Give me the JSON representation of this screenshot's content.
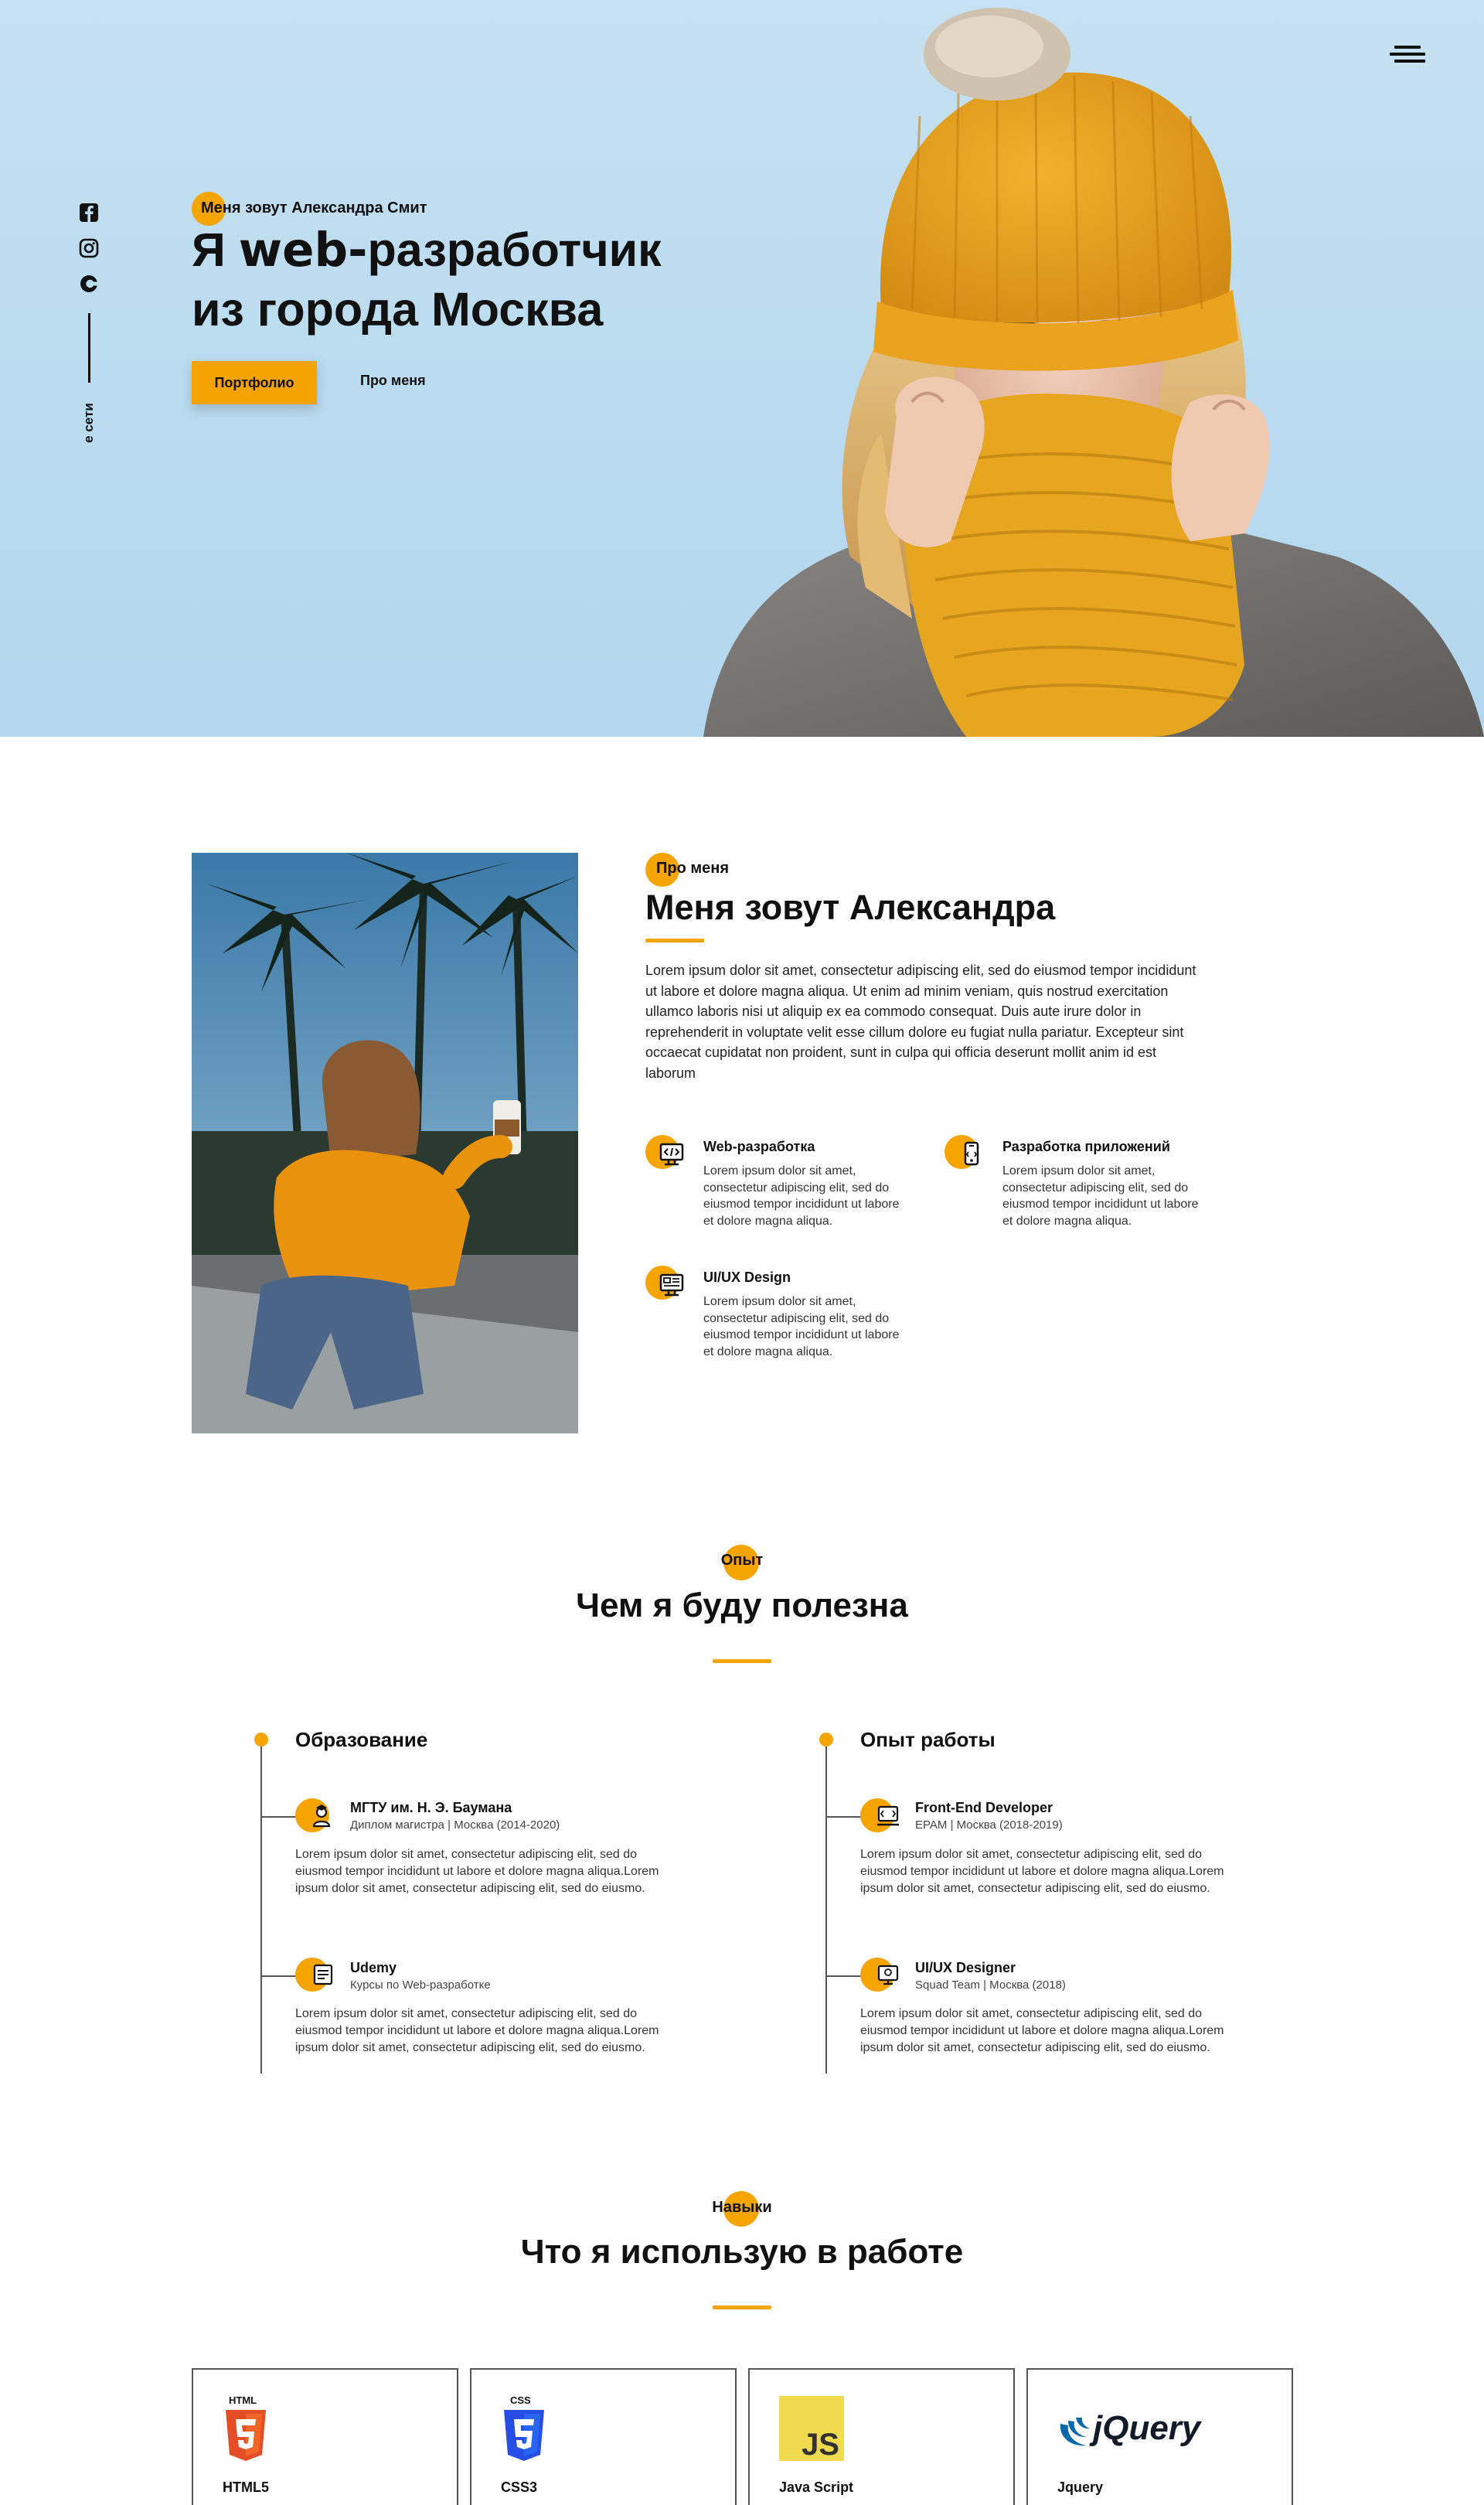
{
  "hero": {
    "eyebrow": "Меня зовут Александра Смит",
    "title_part1": "Я ",
    "title_bold": "web-",
    "title_part2": "разработчик",
    "title_line2": "из города Москва",
    "btn_portfolio": "Портфолио",
    "btn_about": "Про меня",
    "social_label": "е сети",
    "social_icons": [
      "facebook-icon",
      "instagram-icon",
      "codepen-icon"
    ]
  },
  "about": {
    "eyebrow": "Про меня",
    "title": "Меня зовут Александра",
    "text": "Lorem ipsum dolor sit amet, consectetur adipiscing elit, sed do eiusmod tempor incididunt ut labore et dolore magna aliqua. Ut enim ad minim veniam, quis nostrud exercitation ullamco laboris nisi ut aliquip ex ea commodo consequat. Duis aute irure dolor in reprehenderit in voluptate velit esse cillum dolore eu fugiat nulla pariatur. Excepteur sint occaecat cupidatat non proident, sunt in culpa qui officia deserunt mollit anim id est laborum",
    "services": [
      {
        "title": "Web-разработка",
        "text": "Lorem ipsum dolor sit amet, consectetur adipiscing elit, sed do eiusmod tempor incididunt ut labore et dolore magna aliqua.",
        "icon": "code-monitor-icon"
      },
      {
        "title": "Разработка приложений",
        "text": "Lorem ipsum dolor sit amet, consectetur adipiscing elit, sed do eiusmod tempor incididunt ut labore et dolore magna aliqua.",
        "icon": "mobile-icon"
      },
      {
        "title": "UI/UX Design",
        "text": "Lorem ipsum dolor sit amet, consectetur adipiscing elit, sed do eiusmod tempor incididunt ut labore et dolore magna aliqua.",
        "icon": "design-monitor-icon"
      }
    ]
  },
  "experience": {
    "eyebrow": "Опыт",
    "title": "Чем я буду полезна",
    "education": {
      "heading": "Образование",
      "items": [
        {
          "title": "МГТУ им. Н. Э. Баумана",
          "sub": "Диплом магистра | Москва (2014-2020)",
          "text": "Lorem ipsum dolor sit amet, consectetur adipiscing elit, sed do eiusmod tempor incididunt ut labore et dolore magna aliqua.Lorem ipsum dolor sit amet, consectetur adipiscing elit, sed do eiusmo."
        },
        {
          "title": "Udemy",
          "sub": "Курсы по Web-разработке",
          "text": "Lorem ipsum dolor sit amet, consectetur adipiscing elit, sed do eiusmod tempor incididunt ut labore et dolore magna aliqua.Lorem ipsum dolor sit amet, consectetur adipiscing elit, sed do eiusmo."
        }
      ]
    },
    "work": {
      "heading": "Опыт работы",
      "items": [
        {
          "title": "Front-End Developer",
          "sub": "EPAM | Москва (2018-2019)",
          "text": "Lorem ipsum dolor sit amet, consectetur adipiscing elit, sed do eiusmod tempor incididunt ut labore et dolore magna aliqua.Lorem ipsum dolor sit amet, consectetur adipiscing elit, sed do eiusmo."
        },
        {
          "title": "UI/UX Designer",
          "sub": "Squad Team | Москва (2018)",
          "text": "Lorem ipsum dolor sit amet, consectetur adipiscing elit, sed do eiusmod tempor incididunt ut labore et dolore magna aliqua.Lorem ipsum dolor sit amet, consectetur adipiscing elit, sed do eiusmo."
        }
      ]
    }
  },
  "skills": {
    "eyebrow": "Навыки",
    "title": "Что я использую в работе",
    "items": [
      {
        "label": "HTML5",
        "logo_text": "HTML",
        "color": "#e44d26"
      },
      {
        "label": "CSS3",
        "logo_text": "CSS",
        "color": "#2965f1"
      },
      {
        "label": "Java Script",
        "logo_text": "JS",
        "color": "#f0db4f"
      },
      {
        "label": "Jquery",
        "logo_text": "jQuery",
        "color": "#0769ad"
      }
    ]
  },
  "colors": {
    "accent": "#f5a400",
    "hero_bg": "#bcdcf0",
    "text": "#111111"
  }
}
